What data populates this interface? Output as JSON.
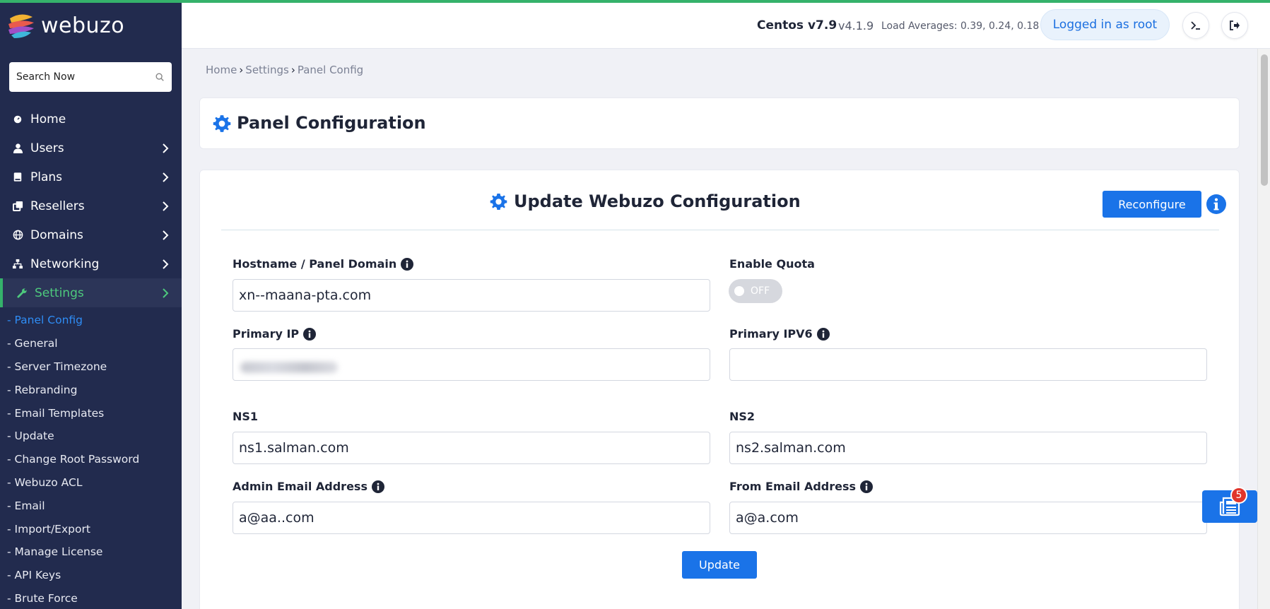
{
  "brand": {
    "name": "webuzo"
  },
  "search": {
    "placeholder": "Search Now"
  },
  "nav": {
    "items": [
      {
        "label": "Home"
      },
      {
        "label": "Users"
      },
      {
        "label": "Plans"
      },
      {
        "label": "Resellers"
      },
      {
        "label": "Domains"
      },
      {
        "label": "Networking"
      },
      {
        "label": "Settings"
      }
    ],
    "settings_sub": [
      {
        "label": "- Panel Config"
      },
      {
        "label": "- General"
      },
      {
        "label": "- Server Timezone"
      },
      {
        "label": "- Rebranding"
      },
      {
        "label": "- Email Templates"
      },
      {
        "label": "- Update"
      },
      {
        "label": "- Change Root Password"
      },
      {
        "label": "- Webuzo ACL"
      },
      {
        "label": "- Email"
      },
      {
        "label": "- Import/Export"
      },
      {
        "label": "- Manage License"
      },
      {
        "label": "- API Keys"
      },
      {
        "label": "- Brute Force"
      }
    ]
  },
  "header": {
    "os": "Centos v7.9",
    "version": "v4.1.9",
    "load": "Load Averages: 0.39, 0.24, 0.18",
    "user": "Logged in as root"
  },
  "breadcrumb": [
    "Home",
    "Settings",
    "Panel Config"
  ],
  "page": {
    "title": "Panel Configuration"
  },
  "form": {
    "title": "Update Webuzo Configuration",
    "reconfigure_label": "Reconfigure",
    "update_label": "Update",
    "fields": {
      "hostname": {
        "label": "Hostname / Panel Domain",
        "value": "xn--maana-pta.com"
      },
      "quota": {
        "label": "Enable Quota",
        "state": "OFF"
      },
      "primary_ip": {
        "label": "Primary IP",
        "value": ""
      },
      "primary_ipv6": {
        "label": "Primary IPV6",
        "value": ""
      },
      "ns1": {
        "label": "NS1",
        "value": "ns1.salman.com"
      },
      "ns2": {
        "label": "NS2",
        "value": "ns2.salman.com"
      },
      "admin_email": {
        "label": "Admin Email Address",
        "value": "a@aa..com"
      },
      "from_email": {
        "label": "From Email Address",
        "value": "a@a.com"
      }
    }
  },
  "news": {
    "count": "5"
  },
  "colors": {
    "sidebar": "#222b4e",
    "accent": "#1a73e8",
    "active": "#35b26b",
    "badge": "#e0352b"
  }
}
